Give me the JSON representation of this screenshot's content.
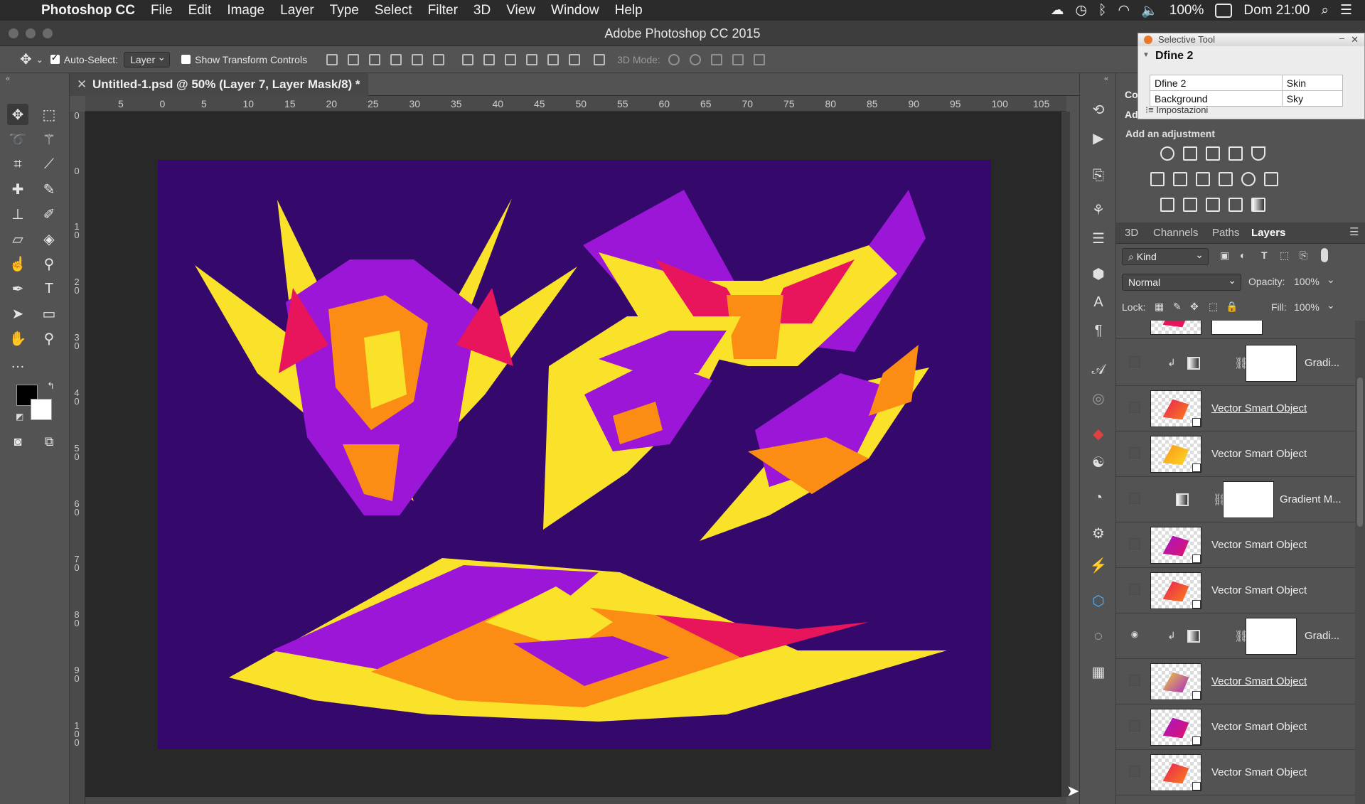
{
  "menubar": {
    "app_name": "Photoshop CC",
    "items": [
      "File",
      "Edit",
      "Image",
      "Layer",
      "Type",
      "Select",
      "Filter",
      "3D",
      "View",
      "Window",
      "Help"
    ],
    "battery": "100%",
    "clock": "Dom 21:00"
  },
  "window": {
    "title": "Adobe Photoshop CC 2015"
  },
  "options": {
    "auto_select_label": "Auto-Select:",
    "auto_select_value": "Layer",
    "show_transform_label": "Show Transform Controls",
    "mode_label": "3D Mode:"
  },
  "document": {
    "tab_title": "Untitled-1.psd @ 50% (Layer 7, Layer Mask/8) *"
  },
  "ruler": {
    "top": [
      "5",
      "0",
      "5",
      "10",
      "15",
      "20",
      "25",
      "30",
      "35",
      "40",
      "45",
      "50",
      "55",
      "60",
      "65",
      "70",
      "75",
      "80",
      "85",
      "90",
      "95",
      "100",
      "105"
    ],
    "left": [
      "0",
      "0",
      "1 0",
      "2 0",
      "3 0",
      "4 0",
      "5 0",
      "6 0",
      "7 0",
      "8 0",
      "9 0",
      "1 0 0"
    ]
  },
  "selective_tool": {
    "title": "Selective Tool",
    "plugin": "Dfine 2",
    "rows": [
      [
        "Dfine 2",
        "Skin"
      ],
      [
        "Background",
        "Sky"
      ]
    ],
    "footer": "Impostazioni"
  },
  "adjustments": {
    "label": "Add an adjustment",
    "panel_tab_1": "Co",
    "panel_tab_2": "Ad"
  },
  "layers_panel": {
    "tabs": [
      "3D",
      "Channels",
      "Paths",
      "Layers"
    ],
    "active_tab": "Layers",
    "filter_value": "Kind",
    "blend_mode": "Normal",
    "opacity_label": "Opacity:",
    "opacity_value": "100%",
    "lock_label": "Lock:",
    "fill_label": "Fill:",
    "fill_value": "100%",
    "layers": [
      {
        "type": "gradient",
        "name": "Gradi...",
        "visible": false
      },
      {
        "type": "smart",
        "name": "Vector Smart Object",
        "underlined": true,
        "visible": false
      },
      {
        "type": "smart",
        "name": "Vector Smart Object",
        "underlined": false,
        "visible": false
      },
      {
        "type": "gradient_map",
        "name": "Gradient M...",
        "visible": false
      },
      {
        "type": "smart",
        "name": "Vector Smart Object",
        "underlined": false,
        "visible": false
      },
      {
        "type": "smart",
        "name": "Vector Smart Object",
        "underlined": false,
        "visible": false
      },
      {
        "type": "gradient",
        "name": "Gradi...",
        "visible": true
      },
      {
        "type": "smart",
        "name": "Vector Smart Object",
        "underlined": true,
        "visible": false
      },
      {
        "type": "smart",
        "name": "Vector Smart Object",
        "underlined": false,
        "visible": false
      },
      {
        "type": "smart",
        "name": "Vector Smart Object",
        "underlined": false,
        "visible": false
      }
    ]
  },
  "colors": {
    "artboard": "#34096b",
    "yellow": "#fbe22a",
    "orange": "#fb8c14",
    "purple": "#9b16d6",
    "magenta": "#e8145c"
  }
}
